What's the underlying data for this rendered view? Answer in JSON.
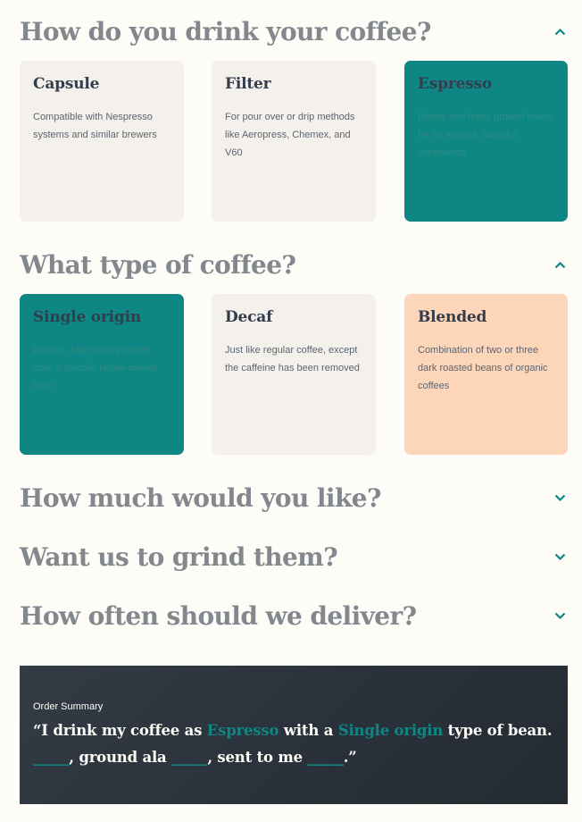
{
  "questions": [
    {
      "title": "How do you drink your coffee?",
      "expanded": true,
      "icon": "chevron-up-icon"
    },
    {
      "title": "What type of coffee?",
      "expanded": true,
      "icon": "chevron-up-icon"
    },
    {
      "title": "How much would you like?",
      "expanded": false,
      "icon": "chevron-down-icon"
    },
    {
      "title": "Want us to grind them?",
      "expanded": false,
      "icon": "chevron-down-icon"
    },
    {
      "title": "How often should we deliver?",
      "expanded": false,
      "icon": "chevron-down-icon"
    }
  ],
  "drink_options": [
    {
      "title": "Capsule",
      "desc": "Compatible with Nespresso systems and similar brewers",
      "selected": false
    },
    {
      "title": "Filter",
      "desc": "For pour over or drip methods like Aeropress, Chemex, and V60",
      "selected": false
    },
    {
      "title": "Espresso",
      "desc": "Dense and finely ground beans for an intense, flavorful experience",
      "selected": true
    }
  ],
  "type_options": [
    {
      "title": "Single origin",
      "desc": "Distinct, high quality coffee from a specific family-owned farm",
      "selected": true
    },
    {
      "title": "Decaf",
      "desc": "Just like regular coffee, except the caffeine has been removed",
      "selected": false
    },
    {
      "title": "Blended",
      "desc": "Combination of two or three dark roasted beans of organic coffees",
      "selected": false,
      "hover": true
    }
  ],
  "summary": {
    "label": "Order Summary",
    "open_quote": "“I drink my coffee as ",
    "method": "Espresso",
    "mid1": " with a ",
    "type": "Single origin",
    "mid2": " type of bean.",
    "quantity": "_____",
    "mid3": ", ground ala ",
    "grind": "_____",
    "mid4": ", sent to me ",
    "frequency": "_____",
    "close_quote": ".”"
  },
  "colors": {
    "accent": "#0E8784",
    "background": "#FEFCF7",
    "card": "#F4F1EC",
    "hover_card": "#FDD6BA",
    "heading": "#83888F",
    "summary_bg": "#2C343E"
  }
}
